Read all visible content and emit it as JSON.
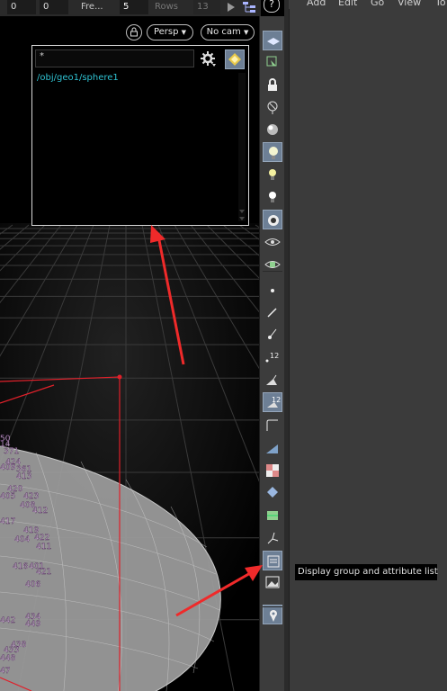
{
  "toolbar": {
    "frame_start": "0",
    "frame_current": "0",
    "free_label": "Fre...",
    "rows_value": "5",
    "rows_label": "Rows",
    "rows_dim_value": "13",
    "help_label": "?"
  },
  "viewport": {
    "camera_mode": "Persp",
    "camera_menu": "No cam",
    "point_numbers": [
      "50",
      "14",
      "371",
      "424",
      "409",
      "361",
      "413",
      "420",
      "405",
      "423",
      "408",
      "412",
      "417",
      "419",
      "404",
      "422",
      "411",
      "416",
      "401",
      "421",
      "406",
      "434",
      "449",
      "442",
      "438",
      "433",
      "448",
      "47"
    ]
  },
  "group_panel": {
    "filter_value": "*",
    "path": "/obj/geo1/sphere1"
  },
  "shelf": {
    "items": [
      {
        "name": "selection-mode-icon",
        "on": true
      },
      {
        "name": "select-objects-icon",
        "on": false
      },
      {
        "name": "lock-icon",
        "on": false
      },
      {
        "name": "ghost-icon",
        "on": false
      },
      {
        "name": "shading-icon",
        "on": false
      },
      {
        "name": "lighting-icon",
        "on": true
      },
      {
        "name": "light-add-icon",
        "on": false
      },
      {
        "name": "light-global-icon",
        "on": false
      },
      {
        "name": "camera-icon",
        "on": true
      },
      {
        "name": "visibility-eye-icon",
        "on": false
      },
      {
        "name": "eye-options-icon",
        "on": false
      },
      {
        "name": "display-points-icon",
        "on": false
      },
      {
        "name": "display-normals-icon",
        "on": false
      },
      {
        "name": "display-point-normals-icon",
        "on": false
      },
      {
        "name": "point-numbers-icon",
        "on": false,
        "label": "12"
      },
      {
        "name": "primitive-normals-icon",
        "on": false
      },
      {
        "name": "primitive-numbers-icon",
        "on": true,
        "label": "12"
      },
      {
        "name": "profile-curves-icon",
        "on": false
      },
      {
        "name": "shaded-faces-icon",
        "on": false
      },
      {
        "name": "texture-checker-icon",
        "on": false
      },
      {
        "name": "uv-display-icon",
        "on": false
      },
      {
        "name": "uv-seams-icon",
        "on": false
      },
      {
        "name": "vector-display-icon",
        "on": false
      },
      {
        "name": "group-list-icon",
        "on": true
      },
      {
        "name": "background-image-icon",
        "on": false
      },
      {
        "name": "snap-icon",
        "on": true
      }
    ],
    "tooltip": "Display group and attribute list"
  },
  "network_menu": [
    "Add",
    "Edit",
    "Go",
    "View",
    "To"
  ],
  "colors": {
    "accent_cyan": "#2fc2d2",
    "selection_red": "#e0202a",
    "arrow_red": "#ef2a2a",
    "button_on": "#6d7f95"
  }
}
